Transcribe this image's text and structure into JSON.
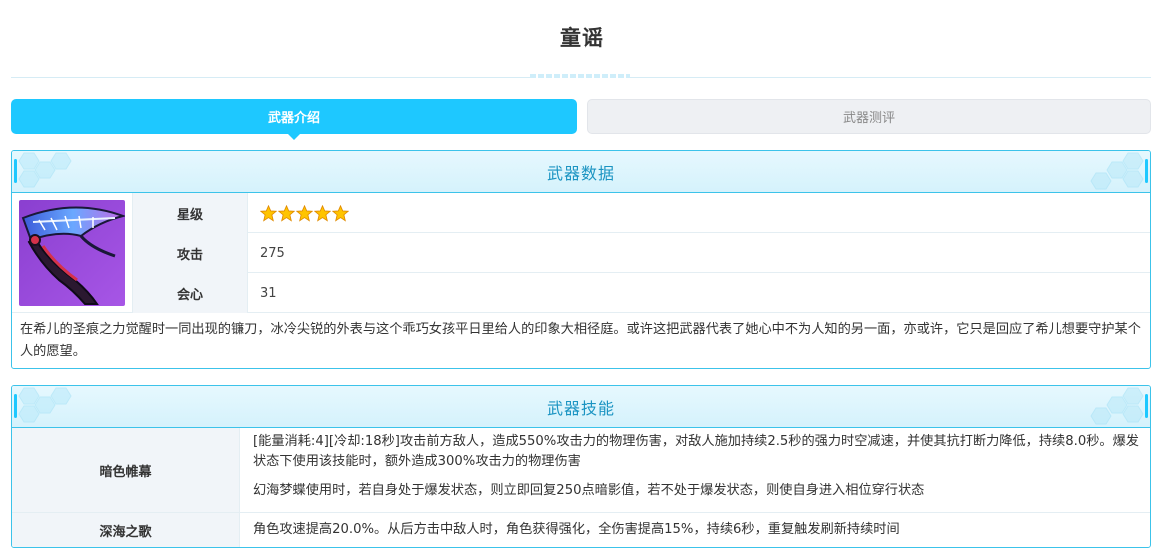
{
  "page": {
    "title": "童谣"
  },
  "tabs": [
    {
      "label": "武器介绍",
      "active": true
    },
    {
      "label": "武器测评",
      "active": false
    }
  ],
  "weapon_data": {
    "header": "武器数据",
    "image_icon": "scythe-weapon-icon",
    "stats": [
      {
        "label": "星级",
        "value": "",
        "stars": 5
      },
      {
        "label": "攻击",
        "value": "275"
      },
      {
        "label": "会心",
        "value": "31"
      }
    ],
    "description": "在希儿的圣痕之力觉醒时一同出现的镰刀，冰冷尖锐的外表与这个乖巧女孩平日里给人的印象大相径庭。或许这把武器代表了她心中不为人知的另一面，亦或许，它只是回应了希儿想要守护某个人的愿望。"
  },
  "weapon_skills": {
    "header": "武器技能",
    "skills": [
      {
        "name": "暗色帷幕",
        "paragraphs": [
          "[能量消耗:4][冷却:18秒]攻击前方敌人，造成550%攻击力的物理伤害，对敌人施加持续2.5秒的强力时空减速，并使其抗打断力降低，持续8.0秒。爆发状态下使用该技能时，额外造成300%攻击力的物理伤害",
          "幻海梦蝶使用时，若自身处于爆发状态，则立即回复250点暗影值，若不处于爆发状态，则使自身进入相位穿行状态"
        ]
      },
      {
        "name": "深海之歌",
        "paragraphs": [
          "角色攻速提高20.0%。从后方击中敌人时，角色获得强化，全伤害提高15%，持续6秒，重复触发刷新持续时间"
        ]
      }
    ]
  },
  "colors": {
    "accent": "#1ec8ff",
    "header_text": "#1b94c2",
    "border": "#3cc3ea",
    "star": "#ffc400"
  }
}
